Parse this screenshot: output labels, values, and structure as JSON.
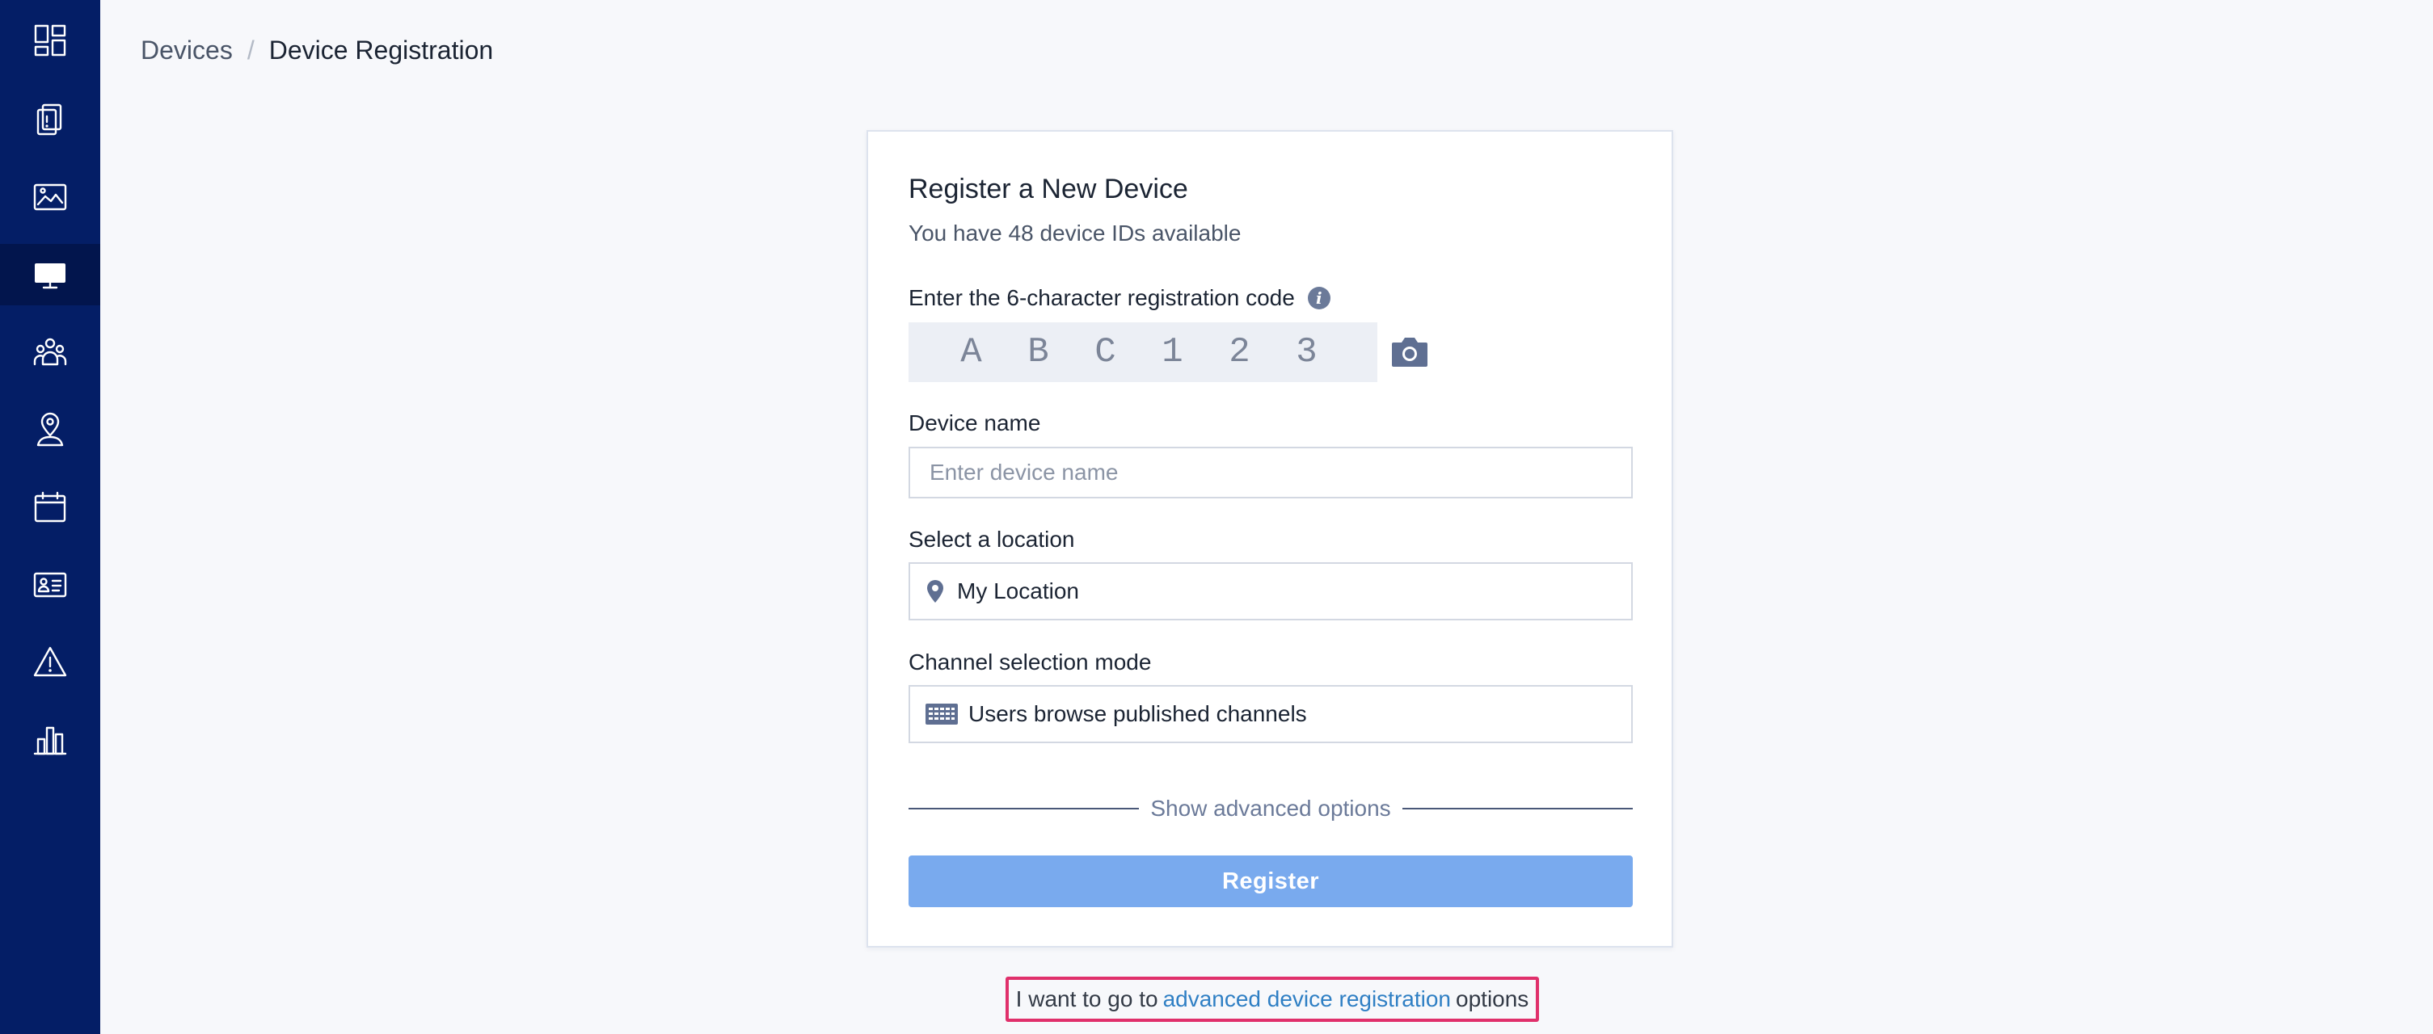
{
  "sidebar": {
    "items": [
      {
        "name": "dashboard",
        "icon": "dashboard-icon",
        "active": false
      },
      {
        "name": "devices-list",
        "icon": "device-alert-icon",
        "active": false
      },
      {
        "name": "media",
        "icon": "image-icon",
        "active": false
      },
      {
        "name": "devices",
        "icon": "monitor-icon",
        "active": true
      },
      {
        "name": "groups",
        "icon": "users-group-icon",
        "active": false
      },
      {
        "name": "locations",
        "icon": "location-person-icon",
        "active": false
      },
      {
        "name": "schedule",
        "icon": "calendar-icon",
        "active": false
      },
      {
        "name": "contacts",
        "icon": "id-card-icon",
        "active": false
      },
      {
        "name": "alerts",
        "icon": "warning-icon",
        "active": false
      },
      {
        "name": "reports",
        "icon": "bar-chart-icon",
        "active": false
      }
    ]
  },
  "breadcrumb": {
    "parent": "Devices",
    "separator": "/",
    "current": "Device Registration"
  },
  "form": {
    "title": "Register a New Device",
    "subtitle": "You have 48 device IDs available",
    "code_label": "Enter the 6-character registration code",
    "code_chars": [
      "A",
      "B",
      "C",
      "1",
      "2",
      "3"
    ],
    "device_name_label": "Device name",
    "device_name_placeholder": "Enter device name",
    "location_label": "Select a location",
    "location_value": "My Location",
    "channel_label": "Channel selection mode",
    "channel_value": "Users browse published channels",
    "advanced_toggle": "Show advanced options",
    "register_label": "Register"
  },
  "footer": {
    "prefix": "I want to go to",
    "link": "advanced device registration",
    "suffix": "options"
  },
  "colors": {
    "sidebar": "#041e66",
    "accent_button": "#79aaee",
    "link": "#2f7fc4",
    "highlight": "#e0306b"
  }
}
